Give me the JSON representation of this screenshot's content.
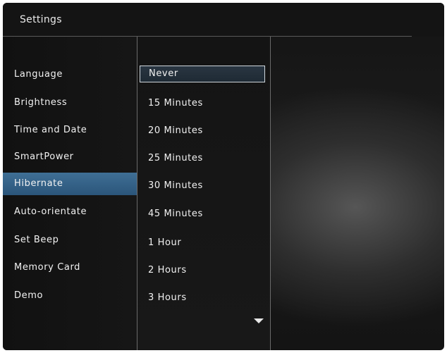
{
  "window": {
    "title": "Settings"
  },
  "menu": {
    "items": [
      {
        "label": "Language"
      },
      {
        "label": "Brightness"
      },
      {
        "label": "Time and Date"
      },
      {
        "label": "SmartPower"
      },
      {
        "label": "Hibernate"
      },
      {
        "label": "Auto-orientate"
      },
      {
        "label": "Set Beep"
      },
      {
        "label": "Memory Card"
      },
      {
        "label": "Demo"
      }
    ],
    "selected": "Hibernate"
  },
  "options": {
    "items": [
      {
        "label": "Never"
      },
      {
        "label": "15 Minutes"
      },
      {
        "label": "20 Minutes"
      },
      {
        "label": "25 Minutes"
      },
      {
        "label": "30 Minutes"
      },
      {
        "label": "45 Minutes"
      },
      {
        "label": "1 Hour"
      },
      {
        "label": "2 Hours"
      },
      {
        "label": "3 Hours"
      }
    ],
    "focused": "Never"
  },
  "icons": {
    "scroll_more": "chevron-down-icon"
  },
  "colors": {
    "selection": "#2f5e85",
    "focus_border": "#cfd6dc",
    "background": "#161616",
    "text": "#f2f2f2"
  }
}
